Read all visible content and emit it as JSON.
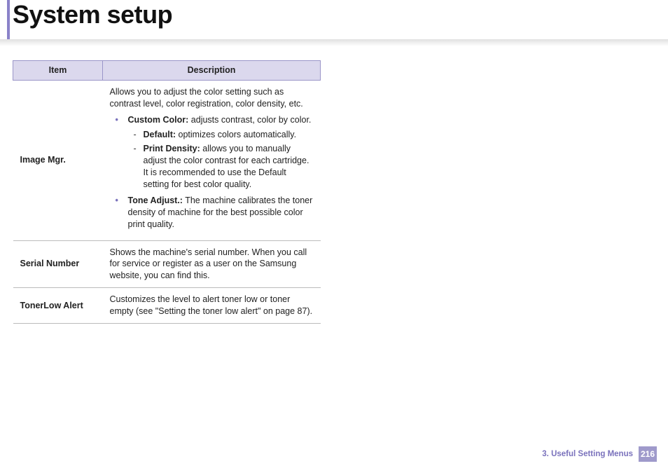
{
  "title": "System setup",
  "columns": {
    "item": "Item",
    "description": "Description"
  },
  "rows": {
    "imageMgr": {
      "item": "Image Mgr.",
      "intro": "Allows you to adjust the color setting such as contrast level, color registration, color density, etc.",
      "customColor": {
        "label": "Custom Color:",
        "text": " adjusts contrast, color by color."
      },
      "default": {
        "label": "Default:",
        "text": " optimizes colors automatically."
      },
      "printDensity": {
        "label": "Print Density:",
        "text": " allows you to manually adjust the color contrast for each cartridge. It is recommended to use the Default setting for best color quality."
      },
      "toneAdjust": {
        "label": "Tone Adjust.:",
        "text": " The machine calibrates the toner density of machine for the best possible color print quality."
      }
    },
    "serialNumber": {
      "item": "Serial Number",
      "text": "Shows the machine's serial number. When you call for service or register as a user on the Samsung website, you can find this."
    },
    "tonerLowAlert": {
      "item": "TonerLow Alert",
      "text": "Customizes the level to alert toner low or toner empty (see \"Setting the toner low alert\" on page 87)."
    }
  },
  "footer": {
    "chapter": "3.  Useful Setting Menus",
    "page": "216"
  }
}
